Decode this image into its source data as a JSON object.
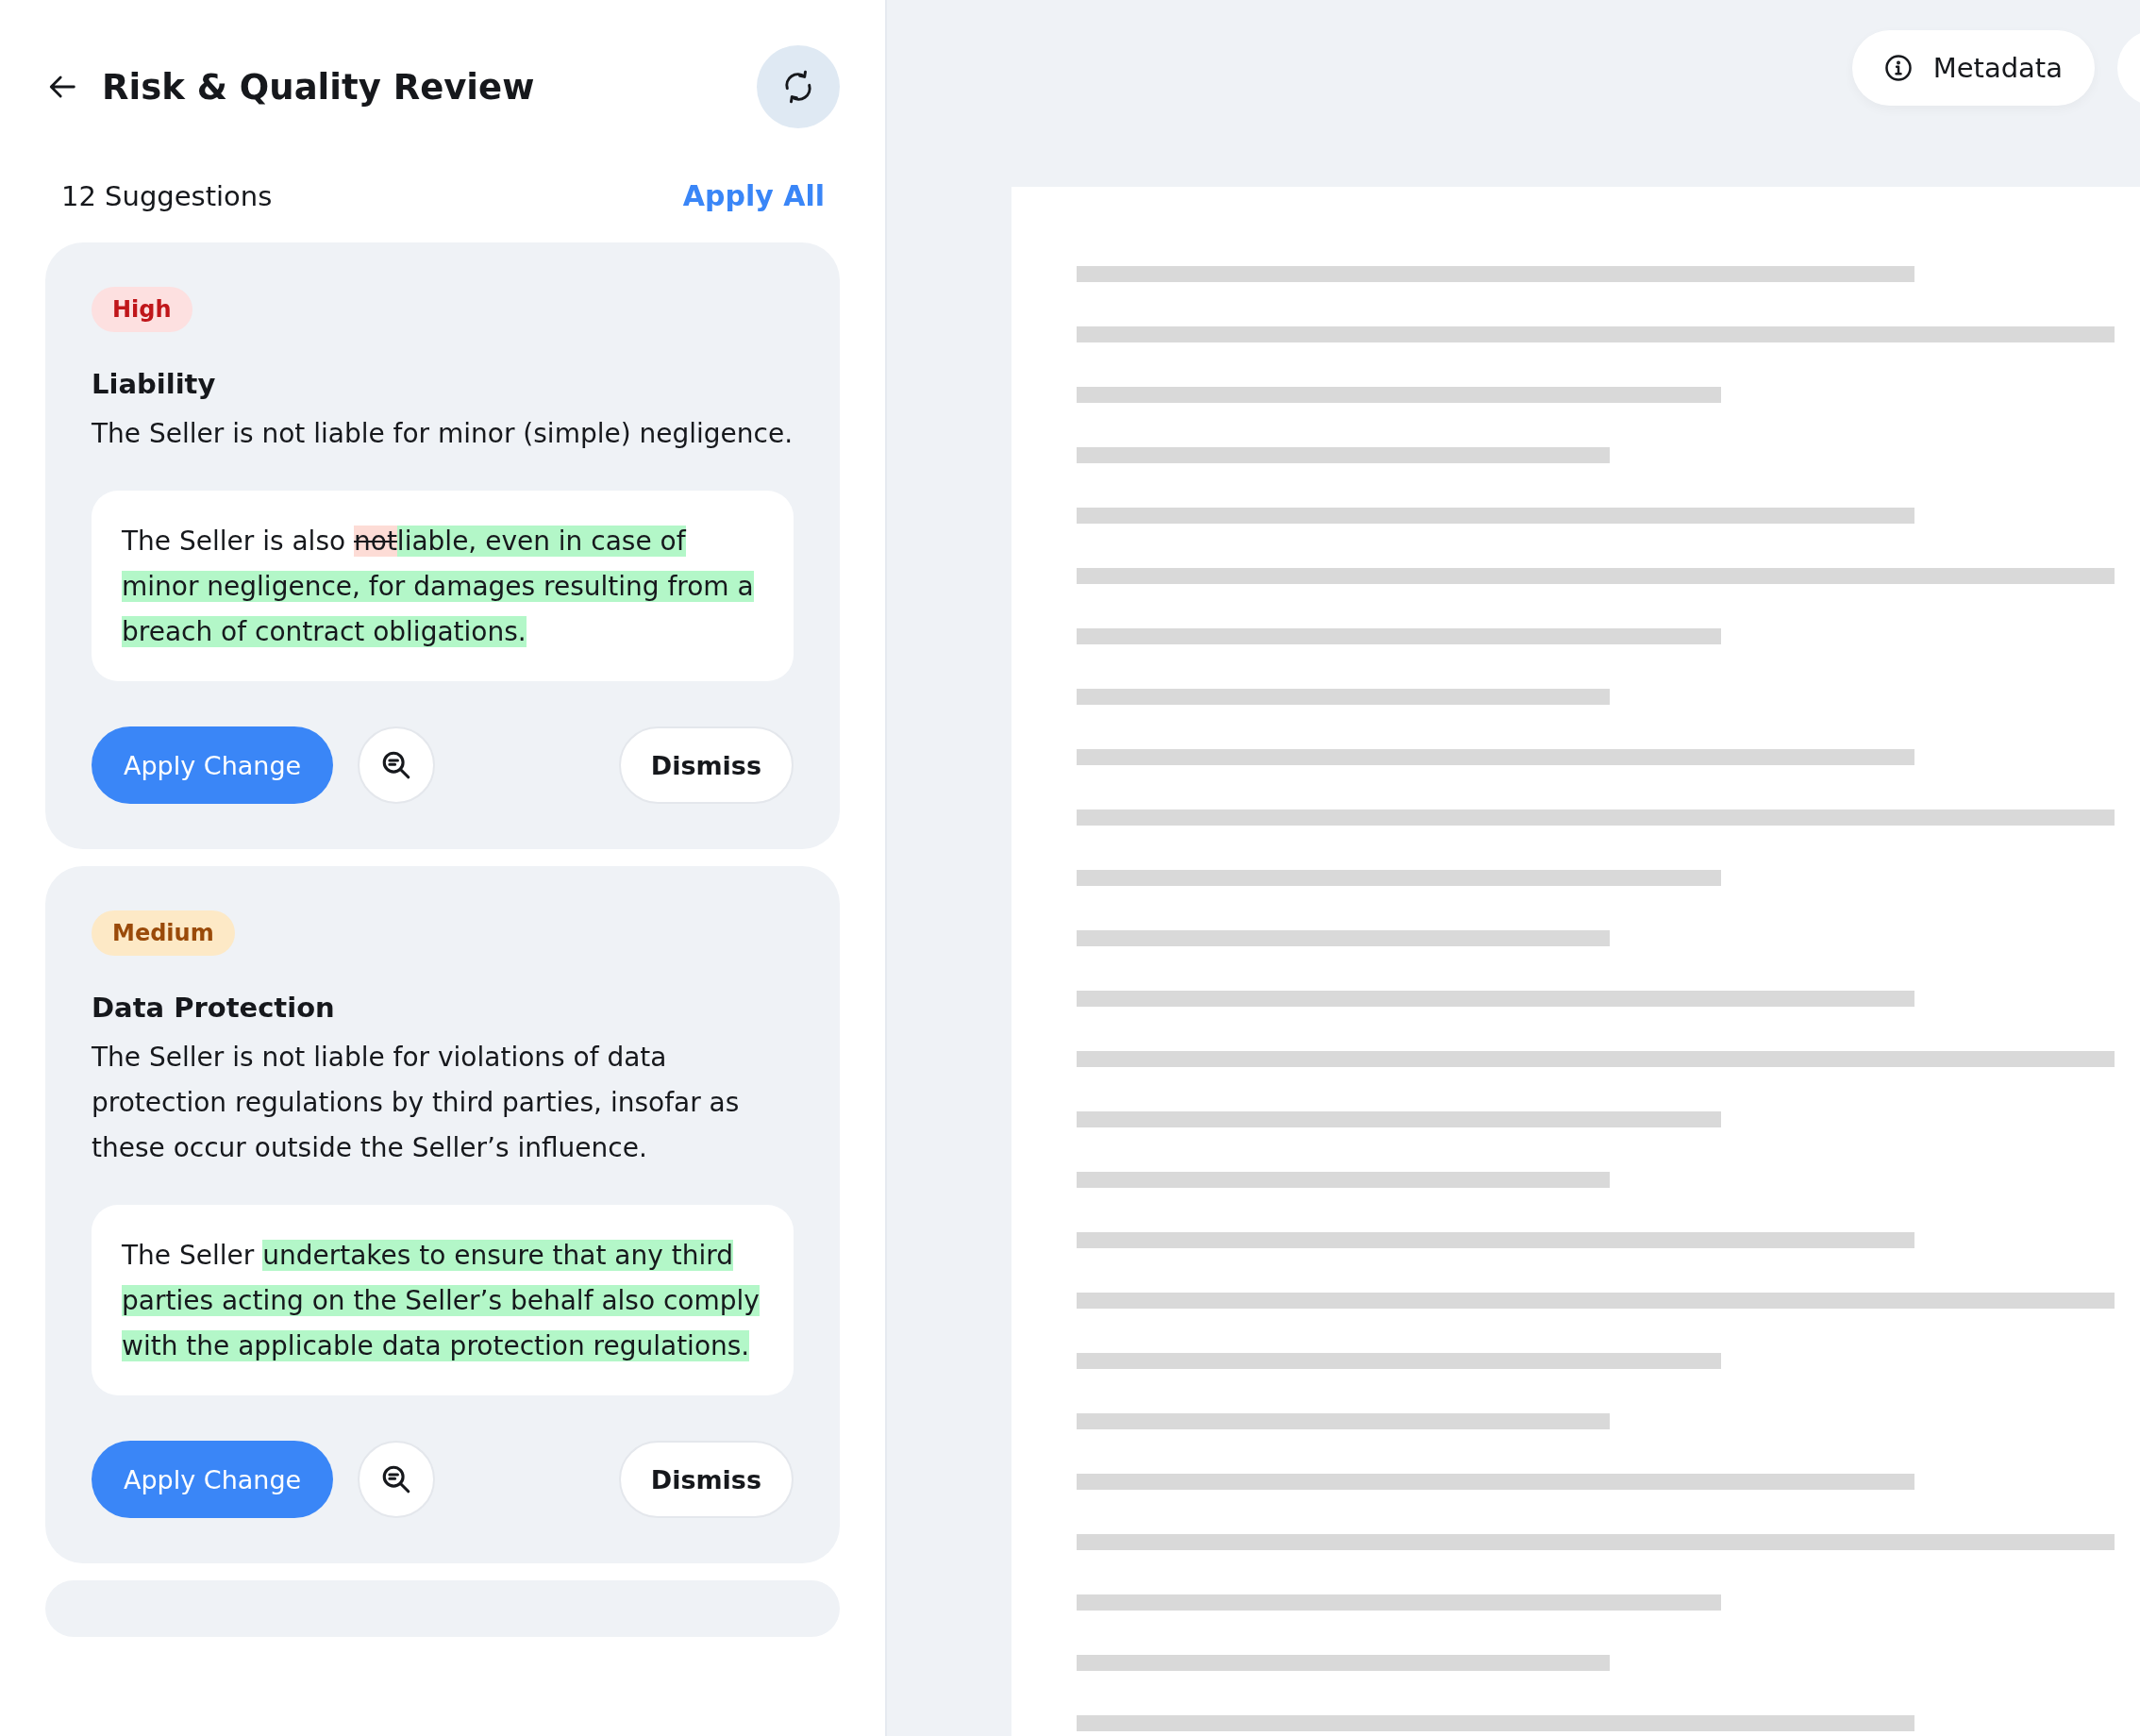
{
  "header": {
    "title": "Risk & Quality Review"
  },
  "summary": {
    "count": "12 Suggestions",
    "apply_all": "Apply All"
  },
  "suggestions": [
    {
      "kind": "high",
      "badge": "High",
      "title": "Liability",
      "description": "The Seller is not liable for minor (simple) negligence.",
      "proposal": [
        {
          "kind": "plain",
          "text": "The Seller is also "
        },
        {
          "kind": "removed",
          "text": "not"
        },
        {
          "kind": "added",
          "text": "liable, even in case of minor negligence, for damages resulting from a breach of contract obligations."
        }
      ],
      "apply": "Apply Change",
      "dismiss": "Dismiss"
    },
    {
      "kind": "medium",
      "badge": "Medium",
      "title": "Data Protection",
      "description": "The Seller is not liable for violations of data protection regulations by third parties, insofar as these occur outside the Seller’s influence.",
      "proposal": [
        {
          "kind": "plain",
          "text": "The Seller "
        },
        {
          "kind": "added",
          "text": "undertakes to ensure that any third parties acting on the Seller’s behalf also comply with the applicable data protection regulations."
        }
      ],
      "apply": "Apply Change",
      "dismiss": "Dismiss"
    }
  ],
  "toolbar": {
    "metadata": "Metadata"
  }
}
